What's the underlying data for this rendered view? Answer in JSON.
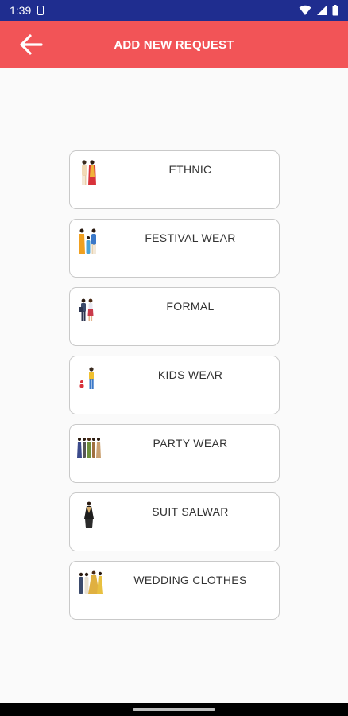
{
  "status_bar": {
    "time": "1:39"
  },
  "app_bar": {
    "title": "ADD NEW REQUEST",
    "back_icon": "arrow-left-icon",
    "color": "#f25457"
  },
  "categories": [
    {
      "label": "ETHNIC",
      "icon": "ethnic-couple-icon"
    },
    {
      "label": "FESTIVAL WEAR",
      "icon": "festival-family-icon"
    },
    {
      "label": "FORMAL",
      "icon": "formal-couple-icon"
    },
    {
      "label": "KIDS WEAR",
      "icon": "kids-icon"
    },
    {
      "label": "PARTY WEAR",
      "icon": "party-group-icon"
    },
    {
      "label": "SUIT SALWAR",
      "icon": "suit-salwar-icon"
    },
    {
      "label": "WEDDING CLOTHES",
      "icon": "wedding-couple-icon"
    }
  ]
}
